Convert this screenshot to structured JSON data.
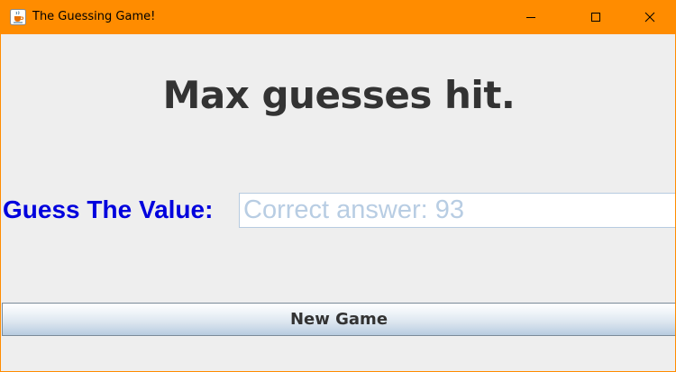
{
  "window": {
    "title": "The Guessing Game!",
    "accent_color": "#ff8c00",
    "app_icon": "java-coffee-cup-icon",
    "controls": [
      "minimize-icon",
      "maximize-icon",
      "close-icon"
    ]
  },
  "main": {
    "status_message": "Max guesses hit.",
    "guess_label": "Guess The Value:",
    "guess_input": {
      "value": "",
      "placeholder": "Correct answer: 93"
    },
    "new_game_label": "New Game",
    "label_color": "#0000dd",
    "status_color": "#333333"
  }
}
